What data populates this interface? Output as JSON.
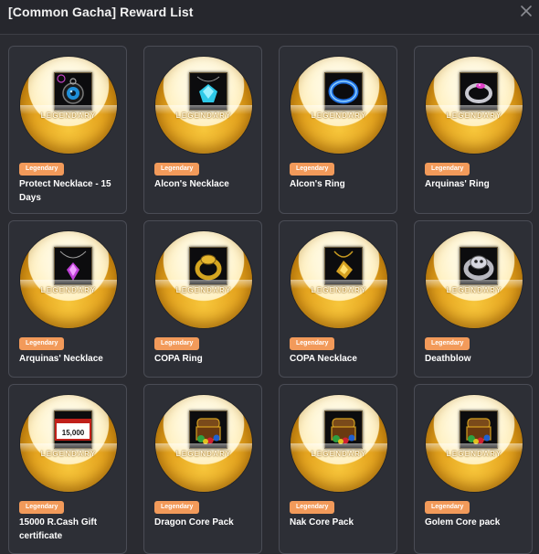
{
  "window": {
    "title": "[Common Gacha] Reward List",
    "close_icon": "close-icon"
  },
  "colors": {
    "background": "#2a2b31",
    "card": "#2d2f36",
    "card_border": "#4a4c55",
    "badge": "#f29a5a",
    "orb_gold": "#e6a620"
  },
  "rewards": [
    {
      "name": "Protect Necklace - 15 Days",
      "rarity_badge": "Legendary",
      "orb_label": "LEGENDARY",
      "icon": "blue-eye-amulet-icon"
    },
    {
      "name": "Alcon's Necklace",
      "rarity_badge": "Legendary",
      "orb_label": "LEGENDARY",
      "icon": "cyan-crystal-necklace-icon"
    },
    {
      "name": "Alcon's Ring",
      "rarity_badge": "Legendary",
      "orb_label": "LEGENDARY",
      "icon": "blue-energy-ring-icon"
    },
    {
      "name": "Arquinas' Ring",
      "rarity_badge": "Legendary",
      "orb_label": "LEGENDARY",
      "icon": "pink-gem-silver-ring-icon"
    },
    {
      "name": "Arquinas' Necklace",
      "rarity_badge": "Legendary",
      "orb_label": "LEGENDARY",
      "icon": "pink-gem-necklace-icon"
    },
    {
      "name": "COPA Ring",
      "rarity_badge": "Legendary",
      "orb_label": "LEGENDARY",
      "icon": "gold-ring-icon"
    },
    {
      "name": "COPA Necklace",
      "rarity_badge": "Legendary",
      "orb_label": "LEGENDARY",
      "icon": "gold-necklace-icon"
    },
    {
      "name": "Deathblow",
      "rarity_badge": "Legendary",
      "orb_label": "LEGENDARY",
      "icon": "silver-skull-ring-icon"
    },
    {
      "name": "15000 R.Cash Gift certificate",
      "rarity_badge": "Legendary",
      "orb_label": "LEGENDARY",
      "icon": "gift-certificate-icon",
      "icon_text": "15,000"
    },
    {
      "name": "Dragon Core Pack",
      "rarity_badge": "Legendary",
      "orb_label": "LEGENDARY",
      "icon": "treasure-chest-icon"
    },
    {
      "name": "Nak Core Pack",
      "rarity_badge": "Legendary",
      "orb_label": "LEGENDARY",
      "icon": "treasure-chest-icon"
    },
    {
      "name": "Golem Core pack",
      "rarity_badge": "Legendary",
      "orb_label": "LEGENDARY",
      "icon": "treasure-chest-icon"
    }
  ]
}
